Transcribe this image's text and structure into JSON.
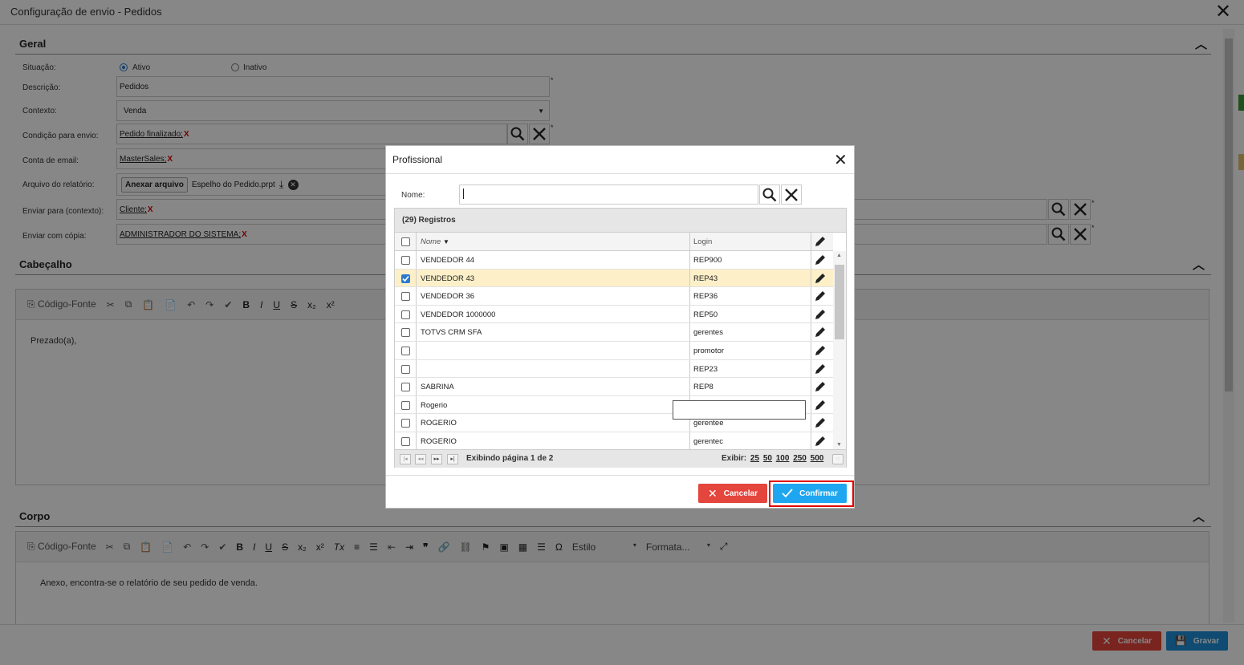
{
  "window": {
    "title": "Configuração de envio - Pedidos"
  },
  "geral": {
    "title": "Geral",
    "situacao_label": "Situação:",
    "ativo": "Ativo",
    "inativo": "Inativo",
    "descricao_label": "Descrição:",
    "descricao_value": "Pedidos",
    "contexto_label": "Contexto:",
    "contexto_value": "Venda",
    "condicao_label": "Condição para envio:",
    "condicao_value": "Pedido finalizado;",
    "conta_label": "Conta de email:",
    "conta_value": "MasterSales;",
    "arquivo_label": "Arquivo do relatório:",
    "anexar_button": "Anexar arquivo",
    "arquivo_value": "Espelho do Pedido.prpt",
    "enviar_label": "Enviar para (contexto):",
    "enviar_value": "Cliente;",
    "copia_label": "Enviar com cópia:",
    "copia_value": "ADMINISTRADOR DO SISTEMA;",
    "remove_mark": "X",
    "required_mark": "*"
  },
  "cabecalho": {
    "title": "Cabeçalho",
    "source_label": "Código-Fonte",
    "body_text": "Prezado(a),"
  },
  "corpo": {
    "title": "Corpo",
    "source_label": "Código-Fonte",
    "estilo": "Estilo",
    "formato": "Formata...",
    "body_text": "Anexo, encontra-se o relatório de seu pedido de venda."
  },
  "footer": {
    "cancel": "Cancelar",
    "save": "Gravar"
  },
  "modal": {
    "title": "Profissional",
    "name_label": "Nome:",
    "name_value": "",
    "records": "(29) Registros",
    "col_nome": "Nome",
    "col_login": "Login",
    "rows": [
      {
        "nome": "VENDEDOR 44",
        "login": "REP900",
        "checked": false
      },
      {
        "nome": "VENDEDOR 43",
        "login": "REP43",
        "checked": true
      },
      {
        "nome": "VENDEDOR 36",
        "login": "REP36",
        "checked": false
      },
      {
        "nome": "VENDEDOR 1000000",
        "login": "REP50",
        "checked": false
      },
      {
        "nome": "TOTVS CRM SFA",
        "login": "gerentes",
        "checked": false
      },
      {
        "nome": "",
        "login": "promotor",
        "checked": false
      },
      {
        "nome": "",
        "login": "REP23",
        "checked": false
      },
      {
        "nome": "SABRINA",
        "login": "REP8",
        "checked": false
      },
      {
        "nome": "Rogerio",
        "login": "",
        "checked": false
      },
      {
        "nome": "ROGERIO",
        "login": "gerentee",
        "checked": false
      },
      {
        "nome": "ROGERIO",
        "login": "gerentec",
        "checked": false
      }
    ],
    "page_info": "Exibindo página 1 de 2",
    "exibir_label": "Exibir:",
    "page_sizes": [
      "25",
      "50",
      "100",
      "250",
      "500"
    ],
    "cancel": "Cancelar",
    "confirm": "Confirmar"
  },
  "colors": {
    "accent": "#2a7ad0",
    "cancel": "#e4453c",
    "confirm": "#1ea7f0",
    "selected_row": "#fdf0c9",
    "highlight": "#e00000"
  }
}
